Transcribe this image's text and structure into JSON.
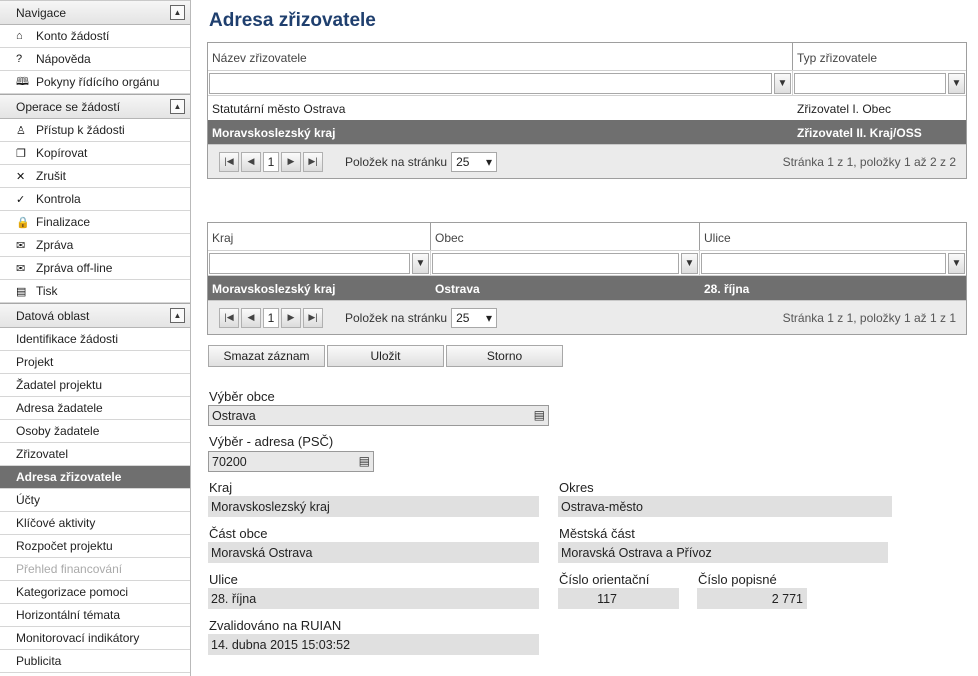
{
  "sidebar": {
    "sections": [
      {
        "title": "Navigace",
        "items": [
          {
            "icon": "house-icon",
            "glyph": "⌂",
            "label": "Konto žádostí"
          },
          {
            "icon": "help-icon",
            "glyph": "?",
            "label": "Nápověda"
          },
          {
            "icon": "book-icon",
            "glyph": "🕮",
            "label": "Pokyny řídícího orgánu"
          }
        ]
      },
      {
        "title": "Operace se žádostí",
        "items": [
          {
            "icon": "user-icon",
            "glyph": "♙",
            "label": "Přístup k žádosti"
          },
          {
            "icon": "copy-icon",
            "glyph": "❐",
            "label": "Kopírovat"
          },
          {
            "icon": "cross-icon",
            "glyph": "✕",
            "label": "Zrušit"
          },
          {
            "icon": "check-icon",
            "glyph": "✓",
            "label": "Kontrola"
          },
          {
            "icon": "lock-icon",
            "glyph": "🔒",
            "label": "Finalizace"
          },
          {
            "icon": "envelope-icon",
            "glyph": "✉",
            "label": "Zpráva"
          },
          {
            "icon": "envelope-icon",
            "glyph": "✉",
            "label": "Zpráva off-line"
          },
          {
            "icon": "print-icon",
            "glyph": "▤",
            "label": "Tisk"
          }
        ]
      },
      {
        "title": "Datová oblast",
        "items": [
          {
            "label": "Identifikace žádosti"
          },
          {
            "label": "Projekt"
          },
          {
            "label": "Žadatel projektu"
          },
          {
            "label": "Adresa žadatele"
          },
          {
            "label": "Osoby žadatele"
          },
          {
            "label": "Zřizovatel"
          },
          {
            "label": "Adresa zřizovatele",
            "active": true
          },
          {
            "label": "Účty"
          },
          {
            "label": "Klíčové aktivity"
          },
          {
            "label": "Rozpočet projektu"
          },
          {
            "label": "Přehled financování",
            "disabled": true
          },
          {
            "label": "Kategorizace pomoci"
          },
          {
            "label": "Horizontální témata"
          },
          {
            "label": "Monitorovací indikátory"
          },
          {
            "label": "Publicita"
          }
        ]
      }
    ]
  },
  "page_title": "Adresa zřizovatele",
  "grid1": {
    "col_name": "Název zřizovatele",
    "col_type": "Typ zřizovatele",
    "rows": [
      {
        "name": "Statutární město Ostrava",
        "type": "Zřizovatel I. Obec"
      },
      {
        "name": "Moravskoslezský kraj",
        "type": "Zřizovatel II. Kraj/OSS"
      }
    ],
    "page": "1",
    "per_page_label": "Položek na stránku",
    "per_page": "25",
    "info": "Stránka 1 z 1, položky 1 až 2 z 2"
  },
  "grid2": {
    "col_kraj": "Kraj",
    "col_obec": "Obec",
    "col_ulice": "Ulice",
    "rows": [
      {
        "kraj": "Moravskoslezský kraj",
        "obec": "Ostrava",
        "ulice": "28. října"
      }
    ],
    "page": "1",
    "per_page_label": "Položek na stránku",
    "per_page": "25",
    "info": "Stránka 1 z 1, položky 1 až 1 z 1"
  },
  "actions": {
    "delete": "Smazat záznam",
    "save": "Uložit",
    "cancel": "Storno"
  },
  "form": {
    "vyber_obce_label": "Výběr obce",
    "vyber_obce": "Ostrava",
    "vyber_adresa_label": "Výběr - adresa (PSČ)",
    "vyber_adresa": "70200",
    "kraj_label": "Kraj",
    "kraj": "Moravskoslezský kraj",
    "okres_label": "Okres",
    "okres": "Ostrava-město",
    "cast_obce_label": "Část obce",
    "cast_obce": "Moravská Ostrava",
    "mestska_cast_label": "Městská část",
    "mestska_cast": "Moravská Ostrava a Přívoz",
    "ulice_label": "Ulice",
    "ulice": "28. října",
    "cislo_orient_label": "Číslo orientační",
    "cislo_orient": "117",
    "cislo_pop_label": "Číslo popisné",
    "cislo_pop": "2 771",
    "zvalidovano_label": "Zvalidováno na RUIAN",
    "zvalidovano": "14. dubna 2015 15:03:52"
  }
}
